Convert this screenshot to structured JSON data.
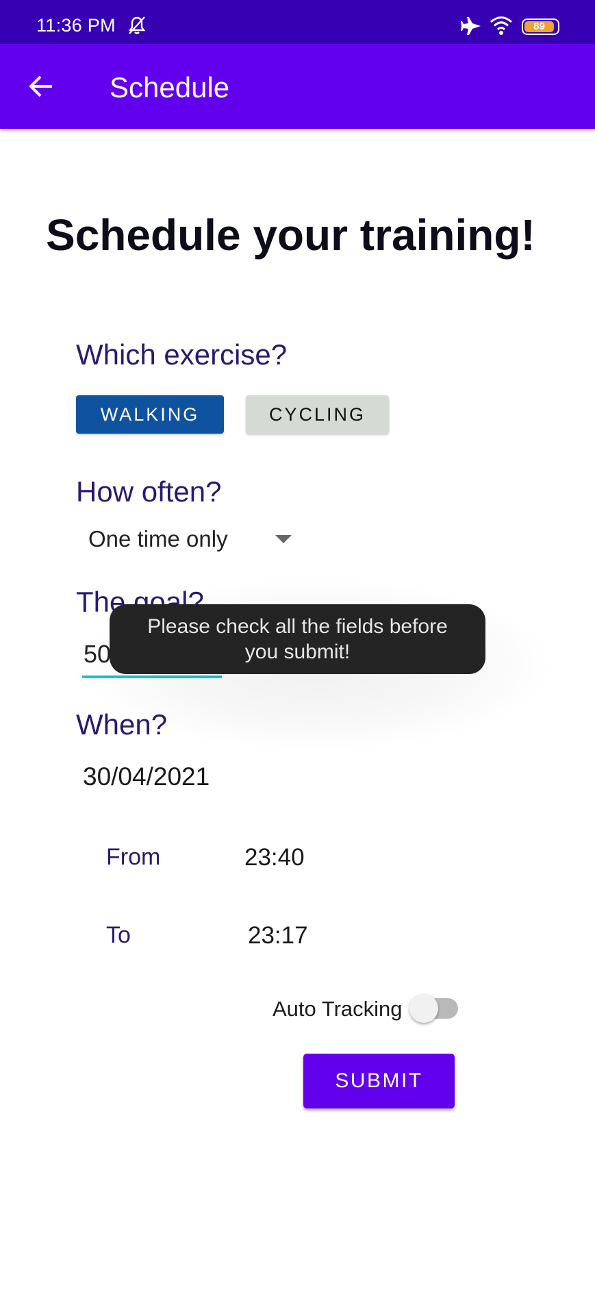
{
  "status_bar": {
    "time": "11:36 PM",
    "battery_level": "89",
    "icons": [
      "silent-icon",
      "airplane-mode-icon",
      "wifi-icon",
      "battery-icon"
    ],
    "background_color": "#3700b3"
  },
  "app_bar": {
    "title": "Schedule",
    "back_icon": "arrow-back-icon",
    "background_color": "#6200ee"
  },
  "page": {
    "heading": "Schedule your training!"
  },
  "exercise": {
    "label": "Which exercise?",
    "options": [
      "WALKING",
      "CYCLING"
    ],
    "selected": "WALKING",
    "selected_color": "#0f52a0"
  },
  "frequency": {
    "label": "How often?",
    "selected_value": "One time only"
  },
  "goal": {
    "label": "The goal?",
    "value": "50",
    "underline_color": "#1ac6c0"
  },
  "when": {
    "label": "When?",
    "date": "30/04/2021",
    "from_label": "From",
    "from_value": "23:40",
    "to_label": "To",
    "to_value": "23:17"
  },
  "auto_tracking": {
    "label": "Auto Tracking",
    "enabled": false
  },
  "submit": {
    "label": "SUBMIT"
  },
  "toast": {
    "message": "Please check all the fields before you submit!"
  }
}
